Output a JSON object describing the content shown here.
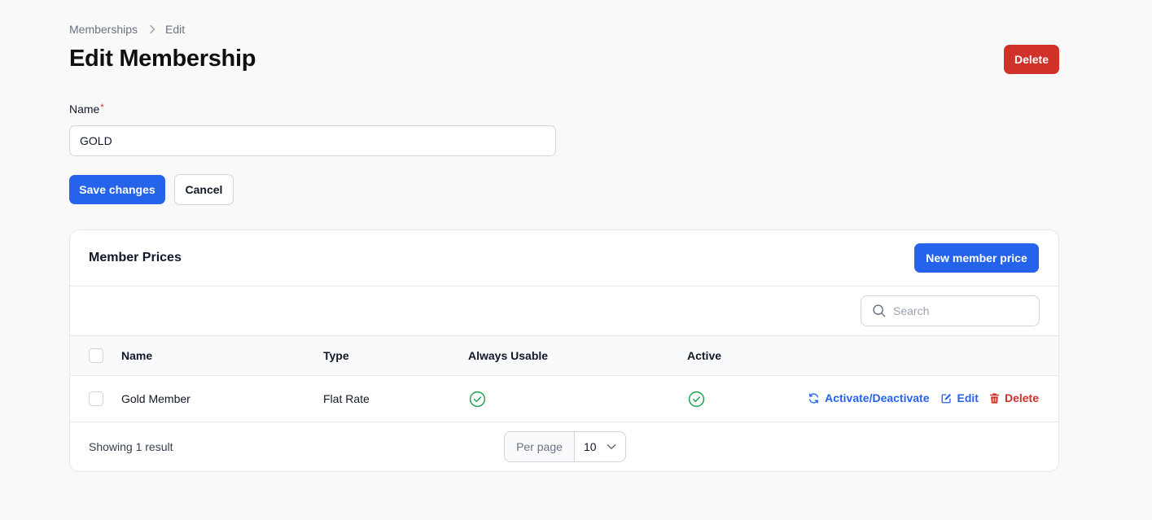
{
  "breadcrumb": {
    "parent": "Memberships",
    "current": "Edit"
  },
  "page": {
    "title": "Edit Membership",
    "delete_label": "Delete"
  },
  "form": {
    "name_label": "Name",
    "required_mark": "*",
    "name_value": "GOLD",
    "save_label": "Save changes",
    "cancel_label": "Cancel"
  },
  "member_prices": {
    "title": "Member Prices",
    "new_label": "New member price",
    "search_placeholder": "Search",
    "columns": [
      "Name",
      "Type",
      "Always Usable",
      "Active"
    ],
    "rows": [
      {
        "name": "Gold Member",
        "type": "Flat Rate",
        "always_usable": true,
        "active": true,
        "actions": {
          "toggle": "Activate/Deactivate",
          "edit": "Edit",
          "delete": "Delete"
        }
      }
    ],
    "footer": {
      "showing": "Showing 1 result",
      "per_page_label": "Per page",
      "per_page_value": "10"
    }
  },
  "colors": {
    "primary": "#2563eb",
    "danger": "#d03128",
    "success": "#16a34a"
  }
}
